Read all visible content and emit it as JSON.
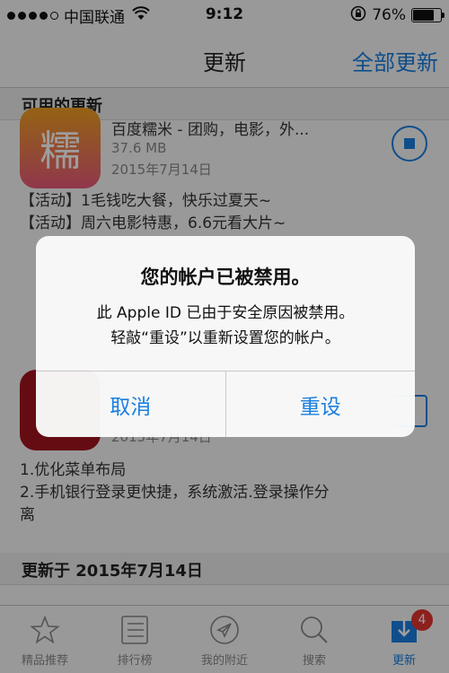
{
  "status_bar": {
    "carrier": "中国联通",
    "time": "9:12",
    "battery": "76%",
    "battery_level": 0.76
  },
  "nav": {
    "title": "更新",
    "update_all": "全部更新"
  },
  "sections": {
    "available": "可用的更新",
    "updated_on": "更新于 2015年7月14日"
  },
  "app1": {
    "name": "百度糯米 - 团购，电影，外...",
    "size": "37.6 MB",
    "date": "2015年7月14日",
    "icon_glyph": "糯",
    "notes": [
      "【活动】1毛钱吃大餐，快乐过夏天~",
      "【活动】周六电影特惠，6.6元看大片~"
    ]
  },
  "app2": {
    "date": "2015年7月14日",
    "notes": [
      "1.优化菜单布局",
      "2.手机银行登录更快捷，系统激活.登录操作分",
      "离"
    ]
  },
  "alert": {
    "title": "您的帐户已被禁用。",
    "message_line1": "此 Apple ID 已由于安全原因被禁用。",
    "message_line2": "轻敲“重设”以重新设置您的帐户。",
    "cancel": "取消",
    "reset": "重设"
  },
  "tabs": [
    {
      "label": "精品推荐",
      "icon": "star-icon"
    },
    {
      "label": "排行榜",
      "icon": "list-icon"
    },
    {
      "label": "我的附近",
      "icon": "location-icon"
    },
    {
      "label": "搜索",
      "icon": "search-icon"
    },
    {
      "label": "更新",
      "icon": "update-icon",
      "badge": "4"
    }
  ],
  "colors": {
    "accent": "#1a7fe0",
    "badge": "#e3342f"
  }
}
